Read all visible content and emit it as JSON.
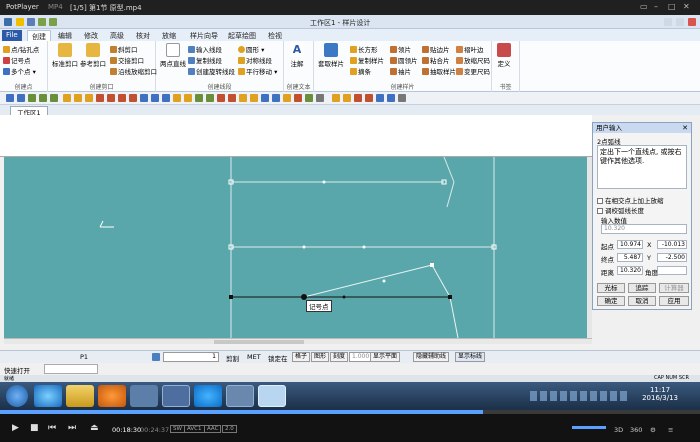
{
  "player": {
    "app_name": "PotPlayer",
    "format": "MP4",
    "title": "[1/5] 第1节  原型.mp4",
    "time_current": "00:18:30",
    "time_total": "00:24:37",
    "badges": [
      "SW",
      "AVC1",
      "AAC",
      "2.0"
    ],
    "progress": 0.69,
    "right_labels": [
      "3D",
      "360",
      "⚙",
      "≡"
    ]
  },
  "app": {
    "window_title": "工作区1 - 样片设计",
    "menu": [
      "File",
      "创建",
      "编辑",
      "修改",
      "高级",
      "核对",
      "放缩",
      "样片向导",
      "起草绘图",
      "检视"
    ],
    "doc_tab": "工作区1",
    "ribbon": {
      "groups": [
        {
          "label": "创建点",
          "items": [
            "点/钻孔点",
            "记号点",
            "多个点 ▾"
          ]
        },
        {
          "label": "创建剪口",
          "items": [
            "标准剪口",
            "参考剪口",
            "斜剪口",
            "交接剪口",
            "沿线放缩剪口"
          ]
        },
        {
          "label": "创建线段",
          "items": [
            "两点直线",
            "输入线段",
            "复制线段",
            "创建旋转线段",
            "圆形 ▾",
            "对称线段",
            "平行移动 ▾"
          ]
        },
        {
          "label": "创建文本",
          "items": [
            "注解"
          ]
        },
        {
          "label": "创建样片",
          "items": [
            "套取样片",
            "长方形",
            "复制样片",
            "摘条",
            "领片",
            "圆领片",
            "袖片",
            "贴边片",
            "粘合片",
            "抽取样片",
            "褶叶边",
            "放缩尺码",
            "变更尺码"
          ]
        },
        {
          "label": "书签",
          "items": [
            "定义"
          ]
        }
      ]
    },
    "canvas_tooltip": "记号点",
    "panel": {
      "title": "用户输入",
      "subtitle": "2点弧线",
      "prompt": "定出下一个直线点, 或按右键作其他选项.",
      "checkbox1": "在相交点上加上放缩",
      "checkbox2": "调校弧线长度",
      "input_label": "输入数值",
      "input_value": "10.320",
      "rows": [
        {
          "label": "起点",
          "v1": "10.974",
          "axis": "X",
          "v2": "-10.013"
        },
        {
          "label": "终点",
          "v1": "5.487",
          "axis": "Y",
          "v2": "-2.500"
        },
        {
          "label": "距离",
          "v1": "10.320",
          "axis": "角度",
          "v2": ""
        }
      ],
      "btn_row1": [
        "光标",
        "追踪",
        "计算器"
      ],
      "btn_row2": [
        "确定",
        "取消",
        "应用"
      ]
    },
    "status": {
      "piece": "P1",
      "qty": "1",
      "mode": "剪割",
      "unit": "MET",
      "lock": "锁定在",
      "grid": "格子",
      "shape": "图形",
      "bevel": "刻度",
      "scale": "1.000",
      "flat": "显示平面",
      "aux": "隐藏辅助线",
      "show_grade": "显示标线",
      "fast_open_label": "快速打开",
      "bottom_left": "就绪",
      "bottom_right": "CAP  NUM  SCR"
    }
  },
  "taskbar": {
    "time": "11:17",
    "date": "2016/3/13"
  },
  "colors": {
    "canvas": "#5aa7ab",
    "accent": "#2a5aa8",
    "seek": "#5aa0ff"
  }
}
